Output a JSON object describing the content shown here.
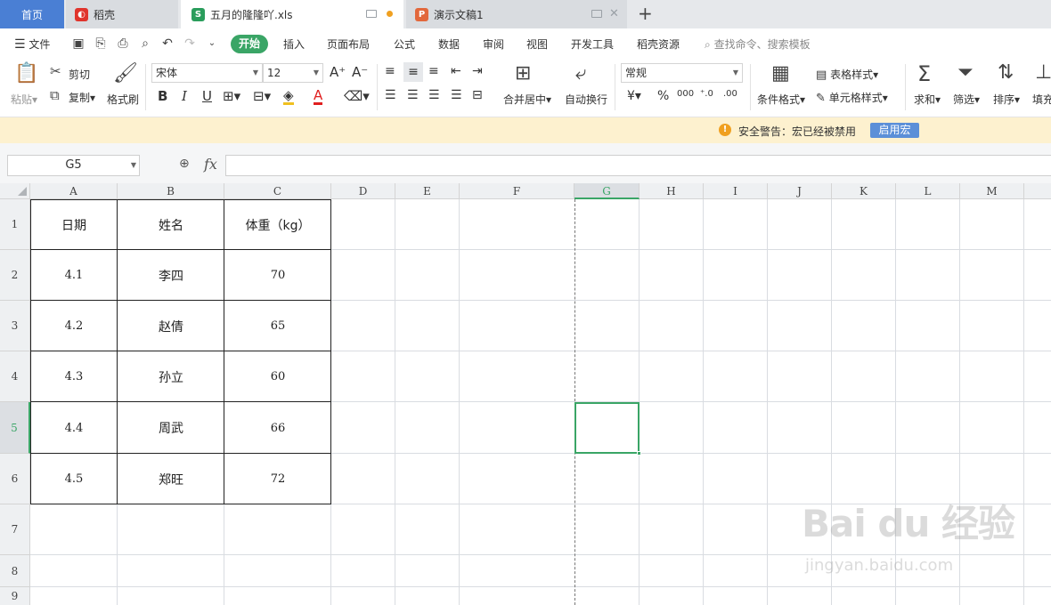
{
  "tabs": {
    "home": "首页",
    "daoke": "稻壳",
    "xls": "五月的隆隆吖.xls",
    "ppt": "演示文稿1"
  },
  "menu": {
    "file": "文件",
    "items": [
      "开始",
      "插入",
      "页面布局",
      "公式",
      "数据",
      "审阅",
      "视图",
      "开发工具",
      "稻壳资源"
    ],
    "search": "查找命令、搜索模板"
  },
  "ribbon": {
    "paste": "粘贴",
    "cut": "剪切",
    "copy": "复制",
    "format_painter": "格式刷",
    "font_name": "宋体",
    "font_size": "12",
    "merge_center": "合并居中",
    "wrap_text": "自动换行",
    "number_format": "常规",
    "cond_format": "条件格式",
    "table_style": "表格样式",
    "cell_style": "单元格样式",
    "sum": "求和",
    "filter": "筛选",
    "sort": "排序",
    "fill": "填充"
  },
  "warning": {
    "text": "安全警告：宏已经被禁用",
    "button": "启用宏"
  },
  "formula_bar": {
    "cell_ref": "G5",
    "fx": "fx",
    "value": ""
  },
  "grid": {
    "columns": [
      "A",
      "B",
      "C",
      "D",
      "E",
      "F",
      "G",
      "H",
      "I",
      "J",
      "K",
      "L",
      "M"
    ],
    "rows": [
      "1",
      "2",
      "3",
      "4",
      "5",
      "6",
      "7",
      "8",
      "9"
    ],
    "active_cell": "G5",
    "table": [
      [
        "日期",
        "姓名",
        "体重（kg）"
      ],
      [
        "4.1",
        "李四",
        "70"
      ],
      [
        "4.2",
        "赵倩",
        "65"
      ],
      [
        "4.3",
        "孙立",
        "60"
      ],
      [
        "4.4",
        "周武",
        "66"
      ],
      [
        "4.5",
        "郑旺",
        "72"
      ]
    ]
  },
  "watermark": {
    "logo": "Bai du 经验",
    "url": "jingyan.baidu.com"
  },
  "colors": {
    "accent": "#3aa566",
    "home_tab": "#4a7fd4",
    "warning_bg": "#fdf1cf"
  }
}
